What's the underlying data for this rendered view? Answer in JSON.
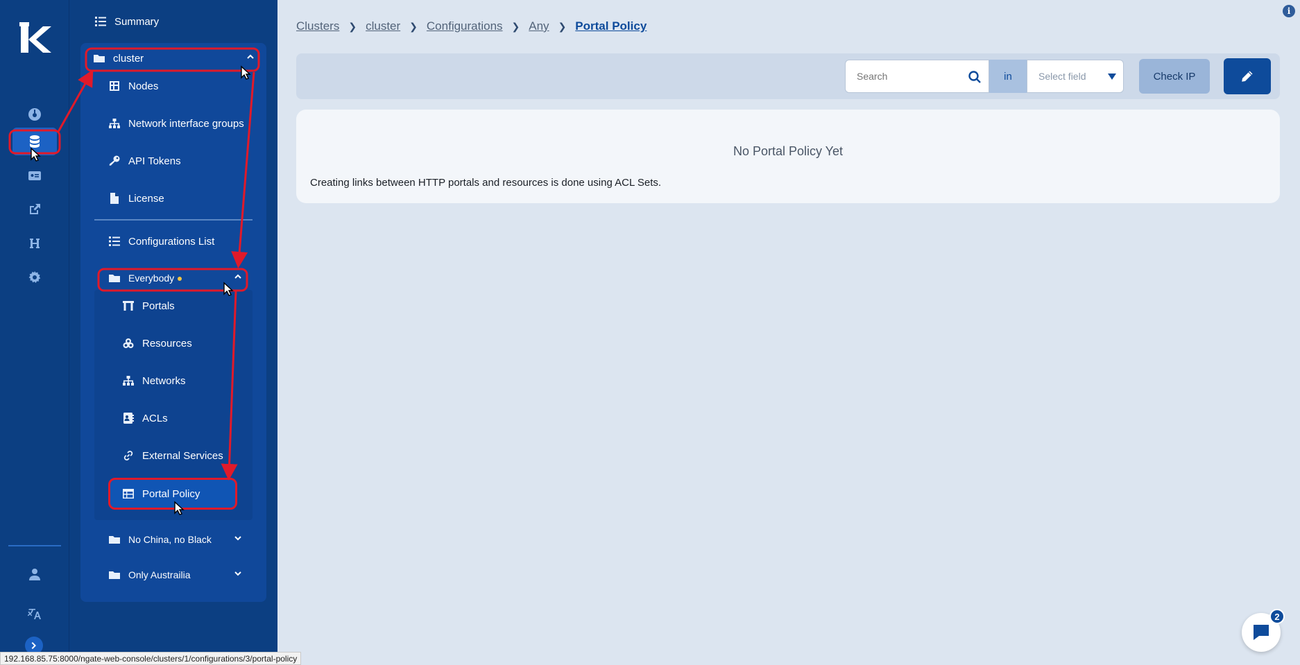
{
  "app": {
    "logo": "K"
  },
  "rail": {
    "items": [
      {
        "icon": "dashboard-icon"
      },
      {
        "icon": "database-icon"
      },
      {
        "icon": "id-card-icon"
      },
      {
        "icon": "external-link-icon"
      },
      {
        "icon": "heading-h-icon"
      },
      {
        "icon": "gear-icon"
      },
      {
        "icon": "user-icon"
      },
      {
        "icon": "translate-icon"
      },
      {
        "icon": "chevron-right-icon"
      }
    ]
  },
  "sidebar": {
    "summary": "Summary",
    "cluster": "cluster",
    "cluster_items": [
      "Nodes",
      "Network interface groups",
      "API Tokens",
      "License"
    ],
    "configurations_list": "Configurations List",
    "everybody": "Everybody",
    "everybody_items": [
      "Portals",
      "Resources",
      "Networks",
      "ACLs",
      "External Services",
      "Portal Policy"
    ],
    "other_groups": [
      "No China, no Black",
      "Only Austrailia"
    ]
  },
  "breadcrumb": [
    "Clusters",
    "cluster",
    "Configurations",
    "Any",
    "Portal Policy"
  ],
  "toolbar": {
    "search_placeholder": "Search",
    "in_label": "in",
    "select_placeholder": "Select field",
    "check_ip": "Check IP"
  },
  "main": {
    "empty_title": "No Portal Policy Yet",
    "empty_desc": "Creating links between HTTP portals and resources is done using ACL Sets."
  },
  "chat": {
    "badge": "2"
  },
  "info": "i",
  "status_url": "192.168.85.75:8000/ngate-web-console/clusters/1/configurations/3/portal-policy",
  "colors": {
    "accent": "#0e4b9b",
    "highlight": "#e01a2a",
    "sidebar": "#0c3f82"
  }
}
